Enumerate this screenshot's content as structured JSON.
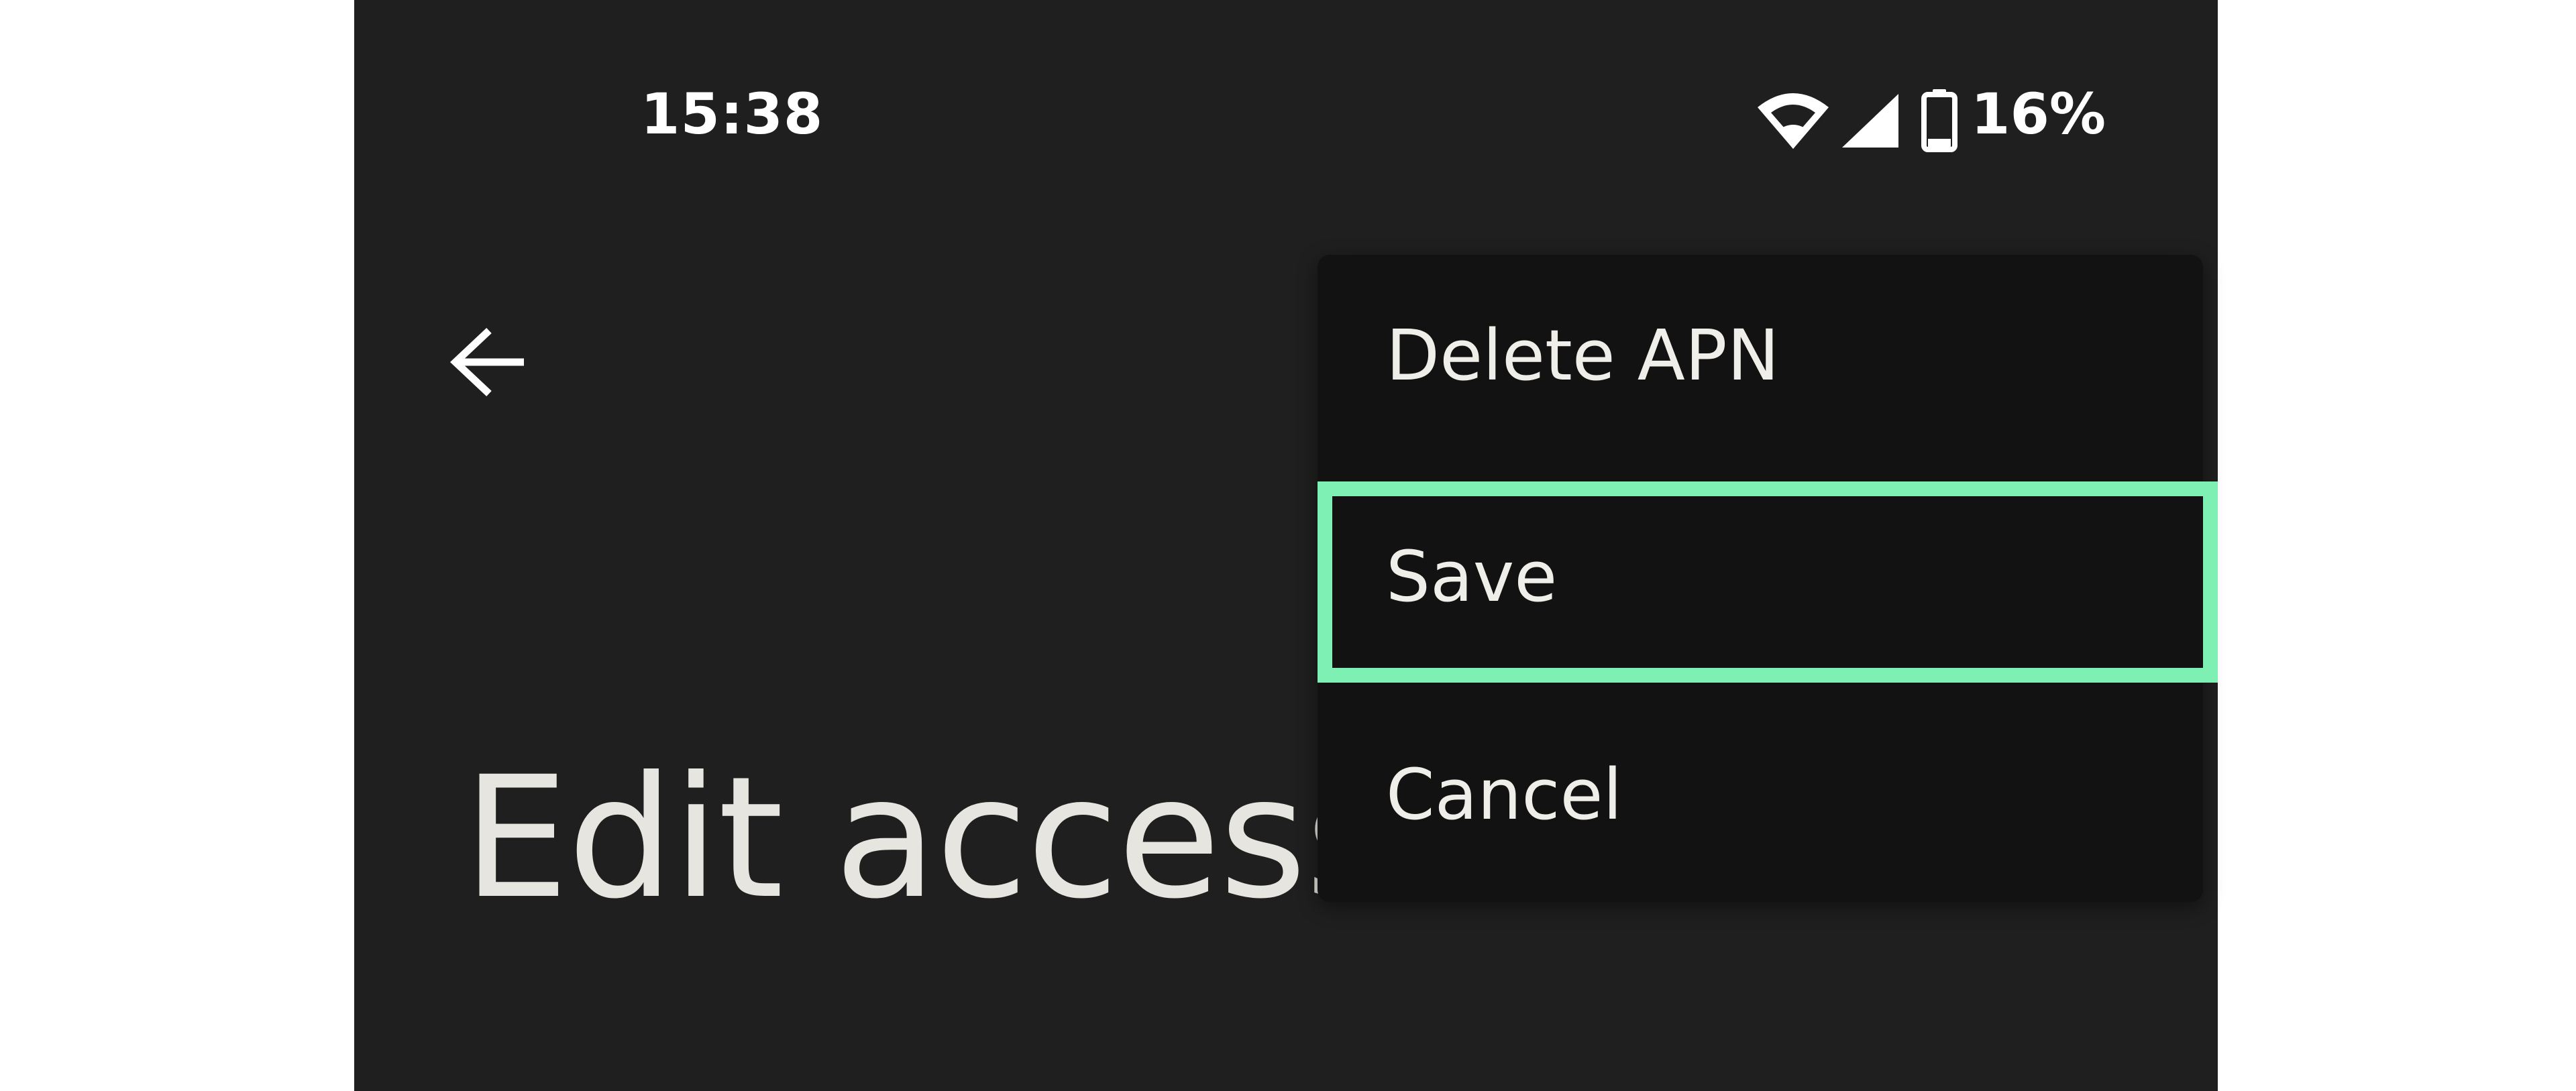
{
  "status_bar": {
    "time": "15:38",
    "battery_percent": "16%",
    "icons": [
      "wifi-icon",
      "signal-icon",
      "battery-icon"
    ]
  },
  "toolbar": {
    "back_icon": "arrow-left-icon"
  },
  "page": {
    "title": "Edit access"
  },
  "overflow_menu": {
    "items": [
      {
        "label": "Delete APN"
      },
      {
        "label": "Save",
        "highlighted": true
      },
      {
        "label": "Cancel"
      }
    ]
  },
  "colors": {
    "background": "#1e1f1e",
    "menu_background": "#121212",
    "highlight": "#7ef0b3",
    "text": "#f0eee8"
  }
}
